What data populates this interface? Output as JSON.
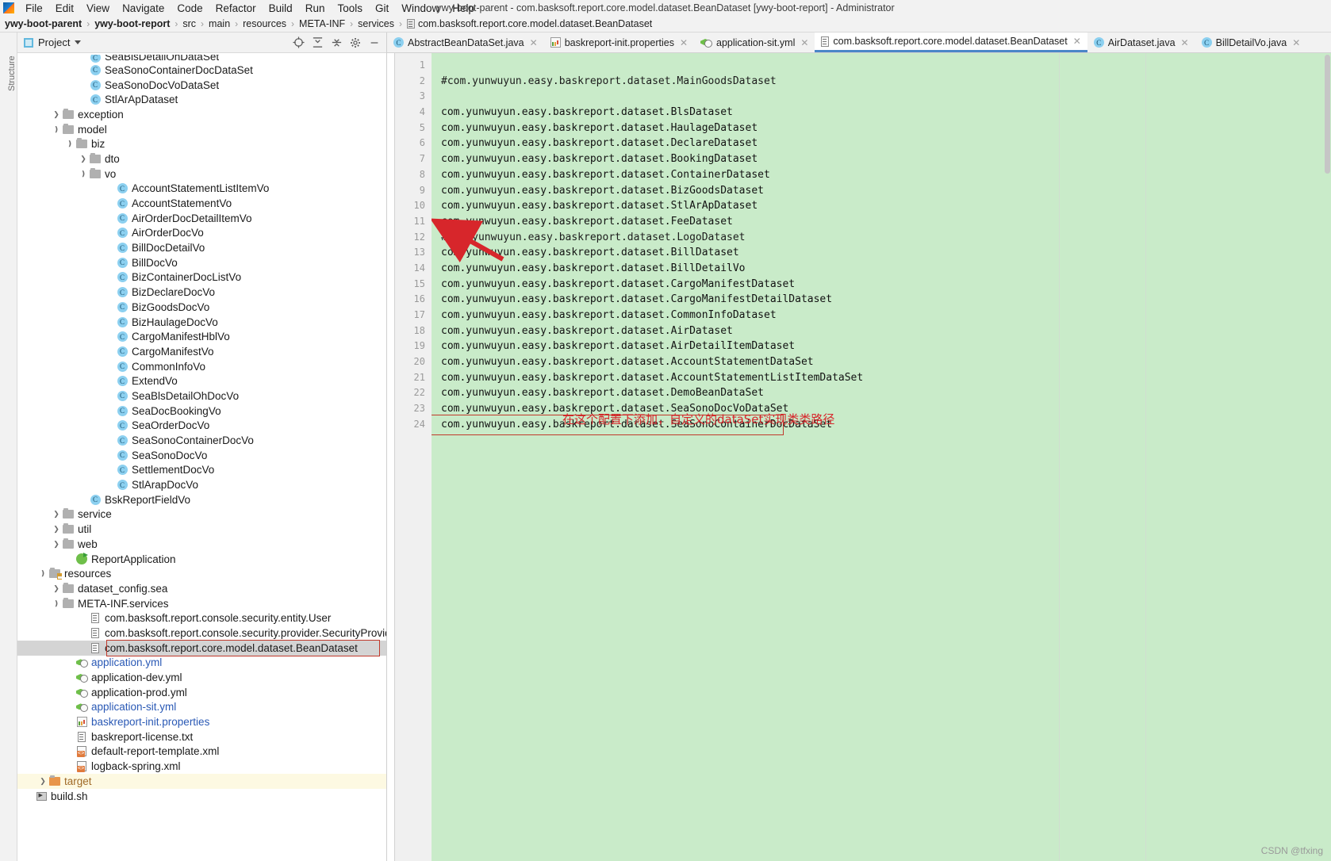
{
  "window": {
    "title": "ywy-boot-parent - com.basksoft.report.core.model.dataset.BeanDataset [ywy-boot-report] - Administrator",
    "app_icon": "intellij-idea-icon"
  },
  "menu": {
    "items": [
      "File",
      "Edit",
      "View",
      "Navigate",
      "Code",
      "Refactor",
      "Build",
      "Run",
      "Tools",
      "Git",
      "Window",
      "Help"
    ]
  },
  "breadcrumb": {
    "items": [
      "ywy-boot-parent",
      "ywy-boot-report",
      "src",
      "main",
      "resources",
      "META-INF",
      "services",
      "com.basksoft.report.core.model.dataset.BeanDataset"
    ],
    "separator": "›"
  },
  "project_panel": {
    "title": "Project",
    "vertical_label": "Structure",
    "toolbar": [
      "locate-icon",
      "collapse-all-icon",
      "expand-all-icon",
      "gear-icon",
      "minimize-icon"
    ],
    "tree": [
      {
        "indent": 5,
        "arrow": "",
        "icon": "class",
        "label": "SeaBlsDetailOhDataSet",
        "color": "normal",
        "clipped": true
      },
      {
        "indent": 5,
        "arrow": "",
        "icon": "class",
        "label": "SeaSonoContainerDocDataSet",
        "color": "normal"
      },
      {
        "indent": 5,
        "arrow": "",
        "icon": "class",
        "label": "SeaSonoDocVoDataSet",
        "color": "normal"
      },
      {
        "indent": 5,
        "arrow": "",
        "icon": "class",
        "label": "StlArApDataset",
        "color": "normal"
      },
      {
        "indent": 3,
        "arrow": "right",
        "icon": "folder",
        "label": "exception",
        "color": "normal"
      },
      {
        "indent": 3,
        "arrow": "down",
        "icon": "folder",
        "label": "model",
        "color": "normal"
      },
      {
        "indent": 4,
        "arrow": "down",
        "icon": "folder",
        "label": "biz",
        "color": "normal"
      },
      {
        "indent": 5,
        "arrow": "right",
        "icon": "folder",
        "label": "dto",
        "color": "normal"
      },
      {
        "indent": 5,
        "arrow": "down",
        "icon": "folder",
        "label": "vo",
        "color": "normal"
      },
      {
        "indent": 7,
        "arrow": "",
        "icon": "class",
        "label": "AccountStatementListItemVo",
        "color": "normal"
      },
      {
        "indent": 7,
        "arrow": "",
        "icon": "class",
        "label": "AccountStatementVo",
        "color": "normal"
      },
      {
        "indent": 7,
        "arrow": "",
        "icon": "class",
        "label": "AirOrderDocDetailItemVo",
        "color": "normal"
      },
      {
        "indent": 7,
        "arrow": "",
        "icon": "class",
        "label": "AirOrderDocVo",
        "color": "normal"
      },
      {
        "indent": 7,
        "arrow": "",
        "icon": "class",
        "label": "BillDocDetailVo",
        "color": "normal"
      },
      {
        "indent": 7,
        "arrow": "",
        "icon": "class",
        "label": "BillDocVo",
        "color": "normal"
      },
      {
        "indent": 7,
        "arrow": "",
        "icon": "class",
        "label": "BizContainerDocListVo",
        "color": "normal"
      },
      {
        "indent": 7,
        "arrow": "",
        "icon": "class",
        "label": "BizDeclareDocVo",
        "color": "normal"
      },
      {
        "indent": 7,
        "arrow": "",
        "icon": "class",
        "label": "BizGoodsDocVo",
        "color": "normal"
      },
      {
        "indent": 7,
        "arrow": "",
        "icon": "class",
        "label": "BizHaulageDocVo",
        "color": "normal"
      },
      {
        "indent": 7,
        "arrow": "",
        "icon": "class",
        "label": "CargoManifestHblVo",
        "color": "normal"
      },
      {
        "indent": 7,
        "arrow": "",
        "icon": "class",
        "label": "CargoManifestVo",
        "color": "normal"
      },
      {
        "indent": 7,
        "arrow": "",
        "icon": "class",
        "label": "CommonInfoVo",
        "color": "normal"
      },
      {
        "indent": 7,
        "arrow": "",
        "icon": "class",
        "label": "ExtendVo",
        "color": "normal"
      },
      {
        "indent": 7,
        "arrow": "",
        "icon": "class",
        "label": "SeaBlsDetailOhDocVo",
        "color": "normal"
      },
      {
        "indent": 7,
        "arrow": "",
        "icon": "class",
        "label": "SeaDocBookingVo",
        "color": "normal"
      },
      {
        "indent": 7,
        "arrow": "",
        "icon": "class",
        "label": "SeaOrderDocVo",
        "color": "normal"
      },
      {
        "indent": 7,
        "arrow": "",
        "icon": "class",
        "label": "SeaSonoContainerDocVo",
        "color": "normal"
      },
      {
        "indent": 7,
        "arrow": "",
        "icon": "class",
        "label": "SeaSonoDocVo",
        "color": "normal"
      },
      {
        "indent": 7,
        "arrow": "",
        "icon": "class",
        "label": "SettlementDocVo",
        "color": "normal"
      },
      {
        "indent": 7,
        "arrow": "",
        "icon": "class",
        "label": "StlArapDocVo",
        "color": "normal"
      },
      {
        "indent": 5,
        "arrow": "",
        "icon": "class",
        "label": "BskReportFieldVo",
        "color": "normal"
      },
      {
        "indent": 3,
        "arrow": "right",
        "icon": "folder",
        "label": "service",
        "color": "normal"
      },
      {
        "indent": 3,
        "arrow": "right",
        "icon": "folder",
        "label": "util",
        "color": "normal"
      },
      {
        "indent": 3,
        "arrow": "right",
        "icon": "folder",
        "label": "web",
        "color": "normal"
      },
      {
        "indent": 4,
        "arrow": "",
        "icon": "spring",
        "label": "ReportApplication",
        "color": "normal"
      },
      {
        "indent": 2,
        "arrow": "down",
        "icon": "folder-src",
        "label": "resources",
        "color": "normal"
      },
      {
        "indent": 3,
        "arrow": "right",
        "icon": "folder",
        "label": "dataset_config.sea",
        "color": "normal"
      },
      {
        "indent": 3,
        "arrow": "down",
        "icon": "folder",
        "label": "META-INF.services",
        "color": "normal"
      },
      {
        "indent": 5,
        "arrow": "",
        "icon": "file",
        "label": "com.basksoft.report.console.security.entity.User",
        "color": "normal"
      },
      {
        "indent": 5,
        "arrow": "",
        "icon": "file",
        "label": "com.basksoft.report.console.security.provider.SecurityProvider",
        "color": "normal"
      },
      {
        "indent": 5,
        "arrow": "",
        "icon": "file",
        "label": "com.basksoft.report.core.model.dataset.BeanDataset",
        "color": "normal",
        "selected": true,
        "boxed": true
      },
      {
        "indent": 4,
        "arrow": "",
        "icon": "yml",
        "label": "application.yml",
        "color": "blue"
      },
      {
        "indent": 4,
        "arrow": "",
        "icon": "yml",
        "label": "application-dev.yml",
        "color": "normal"
      },
      {
        "indent": 4,
        "arrow": "",
        "icon": "yml",
        "label": "application-prod.yml",
        "color": "normal"
      },
      {
        "indent": 4,
        "arrow": "",
        "icon": "yml",
        "label": "application-sit.yml",
        "color": "blue"
      },
      {
        "indent": 4,
        "arrow": "",
        "icon": "prop",
        "label": "baskreport-init.properties",
        "color": "blue"
      },
      {
        "indent": 4,
        "arrow": "",
        "icon": "file",
        "label": "baskreport-license.txt",
        "color": "normal"
      },
      {
        "indent": 4,
        "arrow": "",
        "icon": "xml",
        "label": "default-report-template.xml",
        "color": "normal"
      },
      {
        "indent": 4,
        "arrow": "",
        "icon": "xml",
        "label": "logback-spring.xml",
        "color": "normal"
      },
      {
        "indent": 2,
        "arrow": "right",
        "icon": "folder-orange",
        "label": "target",
        "color": "orange",
        "highlight": true
      },
      {
        "indent": 1,
        "arrow": "",
        "icon": "sh",
        "label": "build.sh",
        "color": "normal"
      }
    ]
  },
  "editor": {
    "tabs": [
      {
        "label": "AbstractBeanDataSet.java",
        "icon": "java-class-icon",
        "active": false
      },
      {
        "label": "baskreport-init.properties",
        "icon": "properties-icon",
        "active": false
      },
      {
        "label": "application-sit.yml",
        "icon": "yml-icon",
        "active": false
      },
      {
        "label": "com.basksoft.report.core.model.dataset.BeanDataset",
        "icon": "file-icon",
        "active": true
      },
      {
        "label": "AirDataset.java",
        "icon": "java-class-icon",
        "active": false
      },
      {
        "label": "BillDetailVo.java",
        "icon": "java-class-icon",
        "active": false
      }
    ],
    "lines": [
      {
        "n": 1,
        "text": "",
        "comment": false
      },
      {
        "n": 2,
        "text": "#com.yunwuyun.easy.baskreport.dataset.MainGoodsDataset",
        "comment": true
      },
      {
        "n": 3,
        "text": "",
        "comment": false
      },
      {
        "n": 4,
        "text": "com.yunwuyun.easy.baskreport.dataset.BlsDataset",
        "comment": false
      },
      {
        "n": 5,
        "text": "com.yunwuyun.easy.baskreport.dataset.HaulageDataset",
        "comment": false
      },
      {
        "n": 6,
        "text": "com.yunwuyun.easy.baskreport.dataset.DeclareDataset",
        "comment": false
      },
      {
        "n": 7,
        "text": "com.yunwuyun.easy.baskreport.dataset.BookingDataset",
        "comment": false
      },
      {
        "n": 8,
        "text": "com.yunwuyun.easy.baskreport.dataset.ContainerDataset",
        "comment": false
      },
      {
        "n": 9,
        "text": "com.yunwuyun.easy.baskreport.dataset.BizGoodsDataset",
        "comment": false
      },
      {
        "n": 10,
        "text": "com.yunwuyun.easy.baskreport.dataset.StlArApDataset",
        "comment": false
      },
      {
        "n": 11,
        "text": "com.yunwuyun.easy.baskreport.dataset.FeeDataset",
        "comment": false
      },
      {
        "n": 12,
        "text": "#com.yunwuyun.easy.baskreport.dataset.LogoDataset",
        "comment": true
      },
      {
        "n": 13,
        "text": "com.yunwuyun.easy.baskreport.dataset.BillDataset",
        "comment": false
      },
      {
        "n": 14,
        "text": "com.yunwuyun.easy.baskreport.dataset.BillDetailVo",
        "comment": false
      },
      {
        "n": 15,
        "text": "com.yunwuyun.easy.baskreport.dataset.CargoManifestDataset",
        "comment": false
      },
      {
        "n": 16,
        "text": "com.yunwuyun.easy.baskreport.dataset.CargoManifestDetailDataset",
        "comment": false
      },
      {
        "n": 17,
        "text": "com.yunwuyun.easy.baskreport.dataset.CommonInfoDataset",
        "comment": false
      },
      {
        "n": 18,
        "text": "com.yunwuyun.easy.baskreport.dataset.AirDataset",
        "comment": false
      },
      {
        "n": 19,
        "text": "com.yunwuyun.easy.baskreport.dataset.AirDetailItemDataset",
        "comment": false
      },
      {
        "n": 20,
        "text": "com.yunwuyun.easy.baskreport.dataset.AccountStatementDataSet",
        "comment": false
      },
      {
        "n": 21,
        "text": "com.yunwuyun.easy.baskreport.dataset.AccountStatementListItemDataSet",
        "comment": false
      },
      {
        "n": 22,
        "text": "com.yunwuyun.easy.baskreport.dataset.DemoBeanDataSet",
        "comment": false
      },
      {
        "n": 23,
        "text": "com.yunwuyun.easy.baskreport.dataset.SeaSonoDocVoDataSet",
        "comment": false
      },
      {
        "n": 24,
        "text": "com.yunwuyun.easy.baskreport.dataset.SeaSonoContainerDocDataSet",
        "comment": false,
        "selected": true,
        "boxed": true
      }
    ]
  },
  "annotation": {
    "text": "在这个配置下添加，自定义的dataSet实现类类路径",
    "color": "#d7262b",
    "arrow": "red-arrow-pointing-from-annotation-to-tree-item"
  },
  "watermark": {
    "text": "CSDN @tfxing"
  }
}
